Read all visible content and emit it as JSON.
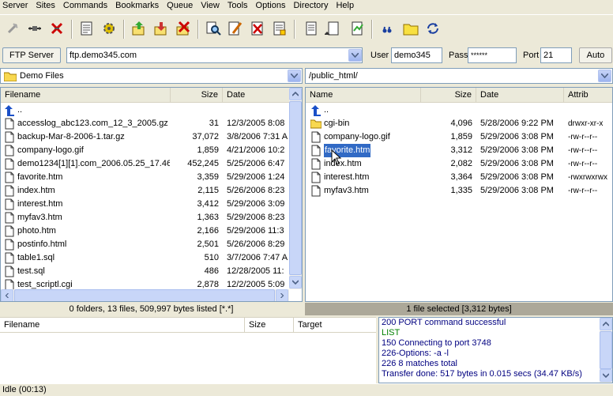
{
  "menu": [
    "Server",
    "Sites",
    "Commands",
    "Bookmarks",
    "Queue",
    "View",
    "Tools",
    "Options",
    "Directory",
    "Help"
  ],
  "toolbar": {
    "icons": [
      "disconnect-icon",
      "connect-icon",
      "abort-icon",
      "site-manager-icon",
      "gear-icon",
      "upload-icon",
      "download-icon",
      "delete-icon",
      "search-icon",
      "edit-icon",
      "cancel-icon",
      "properties-icon",
      "queue-icon",
      "log-icon",
      "refresh-icon",
      "quote-icon",
      "folder-icon",
      "sync-icon"
    ]
  },
  "connection": {
    "ftp_server_label": "FTP Server",
    "host": "ftp.demo345.com",
    "user_label": "User",
    "user": "demo345",
    "pass_label": "Pass",
    "pass": "******",
    "port_label": "Port",
    "port": "21",
    "mode": "Auto"
  },
  "local": {
    "path": "Demo Files",
    "columns": {
      "name": "Filename",
      "size": "Size",
      "date": "Date"
    },
    "up": "..",
    "files": [
      {
        "name": "accesslog_abc123.com_12_3_2005.gz",
        "size": "31",
        "date": "12/3/2005 8:08"
      },
      {
        "name": "backup-Mar-8-2006-1.tar.gz",
        "size": "37,072",
        "date": "3/8/2006 7:31 A"
      },
      {
        "name": "company-logo.gif",
        "size": "1,859",
        "date": "4/21/2006 10:2"
      },
      {
        "name": "demo1234[1][1].com_2006.05.25_17.46",
        "size": "452,245",
        "date": "5/25/2006 6:47"
      },
      {
        "name": "favorite.htm",
        "size": "3,359",
        "date": "5/29/2006 1:24"
      },
      {
        "name": "index.htm",
        "size": "2,115",
        "date": "5/26/2006 8:23"
      },
      {
        "name": "interest.htm",
        "size": "3,412",
        "date": "5/29/2006 3:09"
      },
      {
        "name": "myfav3.htm",
        "size": "1,363",
        "date": "5/29/2006 8:23"
      },
      {
        "name": "photo.htm",
        "size": "2,166",
        "date": "5/29/2006 11:3"
      },
      {
        "name": "postinfo.html",
        "size": "2,501",
        "date": "5/26/2006 8:29"
      },
      {
        "name": "table1.sql",
        "size": "510",
        "date": "3/7/2006 7:47 A"
      },
      {
        "name": "test.sql",
        "size": "486",
        "date": "12/28/2005 11:"
      },
      {
        "name": "test_scriptl.cgi",
        "size": "2,878",
        "date": "12/2/2005 5:09"
      }
    ],
    "status": "0 folders, 13 files, 509,997 bytes listed [*.*]"
  },
  "remote": {
    "path": "/public_html/",
    "columns": {
      "name": "Name",
      "size": "Size",
      "date": "Date",
      "attrib": "Attrib"
    },
    "up": "..",
    "files": [
      {
        "name": "cgi-bin",
        "size": "4,096",
        "date": "5/28/2006 9:22 PM",
        "attrib": "drwxr-xr-x",
        "type": "folder"
      },
      {
        "name": "company-logo.gif",
        "size": "1,859",
        "date": "5/29/2006 3:08 PM",
        "attrib": "-rw-r--r--",
        "type": "file"
      },
      {
        "name": "favorite.htm",
        "size": "3,312",
        "date": "5/29/2006 3:08 PM",
        "attrib": "-rw-r--r--",
        "type": "file",
        "selected": true
      },
      {
        "name": "index.htm",
        "size": "2,082",
        "date": "5/29/2006 3:08 PM",
        "attrib": "-rw-r--r--",
        "type": "file"
      },
      {
        "name": "interest.htm",
        "size": "3,364",
        "date": "5/29/2006 3:08 PM",
        "attrib": "-rwxrwxrwx",
        "type": "file"
      },
      {
        "name": "myfav3.htm",
        "size": "1,335",
        "date": "5/29/2006 3:08 PM",
        "attrib": "-rw-r--r--",
        "type": "file"
      }
    ],
    "status": "1 file selected [3,312 bytes]"
  },
  "queue": {
    "columns": {
      "name": "Filename",
      "size": "Size",
      "target": "Target"
    }
  },
  "log": [
    {
      "text": "200 PORT command successful",
      "color": "#000080"
    },
    {
      "text": "LIST",
      "color": "#008000"
    },
    {
      "text": "150 Connecting to port 3748",
      "color": "#000080"
    },
    {
      "text": "226-Options: -a -l",
      "color": "#000080"
    },
    {
      "text": "226 8 matches total",
      "color": "#000080"
    },
    {
      "text": "Transfer done: 517 bytes in 0.015 secs (34.47 KB/s)",
      "color": "#000080"
    }
  ],
  "statusbar": "Idle (00:13)"
}
